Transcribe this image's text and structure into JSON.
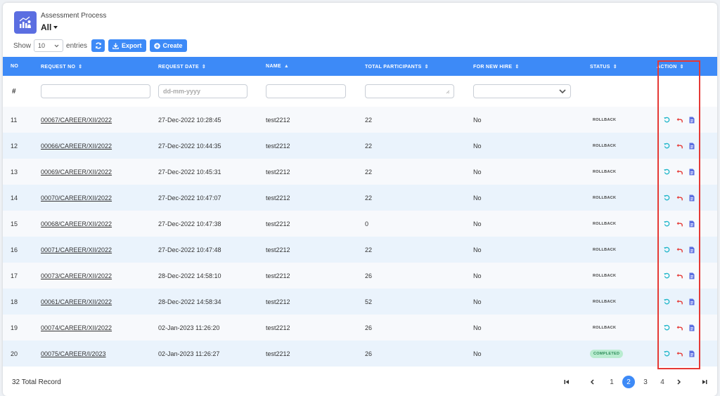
{
  "header": {
    "title": "Assessment Process",
    "filter_value": "All"
  },
  "toolbar": {
    "show_label": "Show",
    "entries_value": "10",
    "entries_label": "entries",
    "export_label": "Export",
    "create_label": "Create"
  },
  "columns": {
    "no": "NO",
    "request_no": "REQUEST NO",
    "request_date": "REQUEST DATE",
    "name": "NAME",
    "total_participants": "TOTAL PARTICIPANTS",
    "for_new_hire": "FOR NEW HIRE",
    "status": "STATUS",
    "action": "ACTION"
  },
  "filters": {
    "no_symbol": "#",
    "date_placeholder": "dd-mm-yyyy"
  },
  "rows": [
    {
      "no": "11",
      "request_no": "00067/CAREER/XII/2022",
      "date": "27-Dec-2022 10:28:45",
      "name": "test2212",
      "participants": "22",
      "new_hire": "No",
      "status": "ROLLBACK"
    },
    {
      "no": "12",
      "request_no": "00066/CAREER/XII/2022",
      "date": "27-Dec-2022 10:44:35",
      "name": "test2212",
      "participants": "22",
      "new_hire": "No",
      "status": "ROLLBACK"
    },
    {
      "no": "13",
      "request_no": "00069/CAREER/XII/2022",
      "date": "27-Dec-2022 10:45:31",
      "name": "test2212",
      "participants": "22",
      "new_hire": "No",
      "status": "ROLLBACK"
    },
    {
      "no": "14",
      "request_no": "00070/CAREER/XII/2022",
      "date": "27-Dec-2022 10:47:07",
      "name": "test2212",
      "participants": "22",
      "new_hire": "No",
      "status": "ROLLBACK"
    },
    {
      "no": "15",
      "request_no": "00068/CAREER/XII/2022",
      "date": "27-Dec-2022 10:47:38",
      "name": "test2212",
      "participants": "0",
      "new_hire": "No",
      "status": "ROLLBACK"
    },
    {
      "no": "16",
      "request_no": "00071/CAREER/XII/2022",
      "date": "27-Dec-2022 10:47:48",
      "name": "test2212",
      "participants": "22",
      "new_hire": "No",
      "status": "ROLLBACK"
    },
    {
      "no": "17",
      "request_no": "00073/CAREER/XII/2022",
      "date": "28-Dec-2022 14:58:10",
      "name": "test2212",
      "participants": "26",
      "new_hire": "No",
      "status": "ROLLBACK"
    },
    {
      "no": "18",
      "request_no": "00061/CAREER/XII/2022",
      "date": "28-Dec-2022 14:58:34",
      "name": "test2212",
      "participants": "52",
      "new_hire": "No",
      "status": "ROLLBACK"
    },
    {
      "no": "19",
      "request_no": "00074/CAREER/XII/2022",
      "date": "02-Jan-2023 11:26:20",
      "name": "test2212",
      "participants": "26",
      "new_hire": "No",
      "status": "ROLLBACK"
    },
    {
      "no": "20",
      "request_no": "00075/CAREER/I/2023",
      "date": "02-Jan-2023 11:26:27",
      "name": "test2212",
      "participants": "26",
      "new_hire": "No",
      "status": "COMPLETED"
    }
  ],
  "footer": {
    "total_records": "32 Total Record",
    "pages": [
      "1",
      "2",
      "3",
      "4"
    ],
    "current_page": "2"
  },
  "colors": {
    "accent": "#3d8af7",
    "header_icon_bg": "#5b6ee1",
    "reload_icon": "#1fb6c9",
    "undo_icon": "#e53935",
    "doc_icon": "#5b6ee1",
    "highlight": "#e53935"
  },
  "icons": {
    "app": "chart-person-icon",
    "refresh": "refresh-icon",
    "export": "download-icon",
    "create": "plus-circle-icon",
    "row_actions": [
      "reload-icon",
      "undo-arrow-icon",
      "document-icon"
    ]
  }
}
